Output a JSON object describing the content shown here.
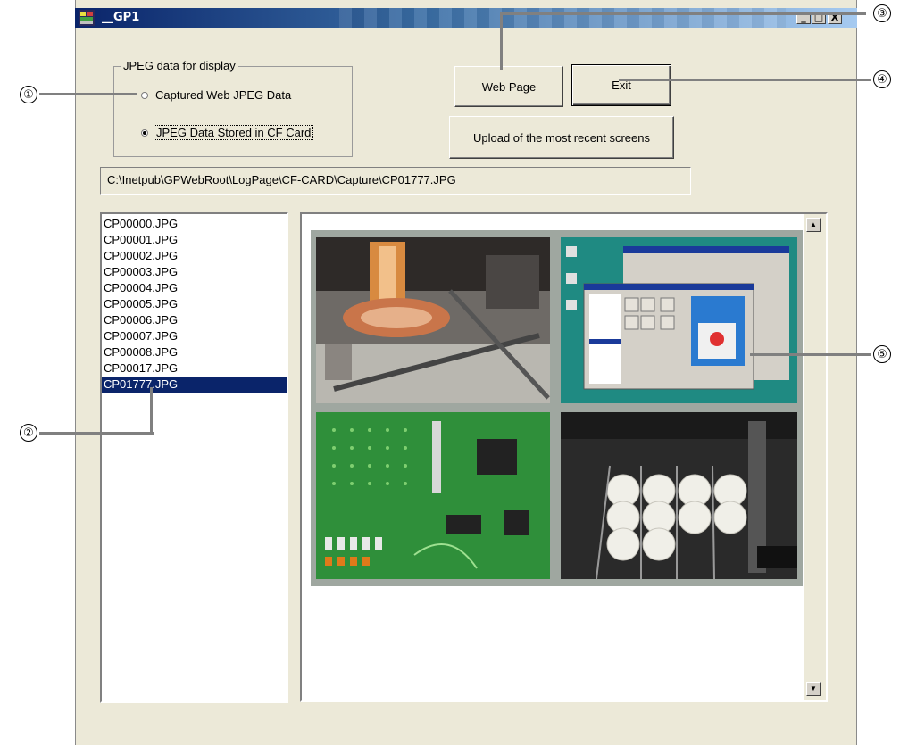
{
  "window": {
    "title": "__GP1",
    "controls": [
      "_",
      "□",
      "X"
    ]
  },
  "group": {
    "legend": "JPEG data for display",
    "options": [
      {
        "label": "Captured Web JPEG Data",
        "selected": false
      },
      {
        "label": "JPEG Data Stored in CF Card",
        "selected": true
      }
    ]
  },
  "buttons": {
    "web_page": "Web Page",
    "exit": "Exit",
    "upload": "Upload of the most recent screens"
  },
  "path": "C:\\Inetpub\\GPWebRoot\\LogPage\\CF-CARD\\Capture\\CP01777.JPG",
  "files": [
    "CP00000.JPG",
    "CP00001.JPG",
    "CP00002.JPG",
    "CP00003.JPG",
    "CP00004.JPG",
    "CP00005.JPG",
    "CP00006.JPG",
    "CP00007.JPG",
    "CP00008.JPG",
    "CP00017.JPG",
    "CP01777.JPG"
  ],
  "selected_file": "CP01777.JPG",
  "scrollbar": {
    "up": "▲",
    "down": "▼"
  },
  "callouts": [
    "①",
    "②",
    "③",
    "④",
    "⑤"
  ],
  "colors": {
    "title_start": "#0a246a",
    "selection": "#0a246a",
    "window_bg": "#ece9d8"
  }
}
